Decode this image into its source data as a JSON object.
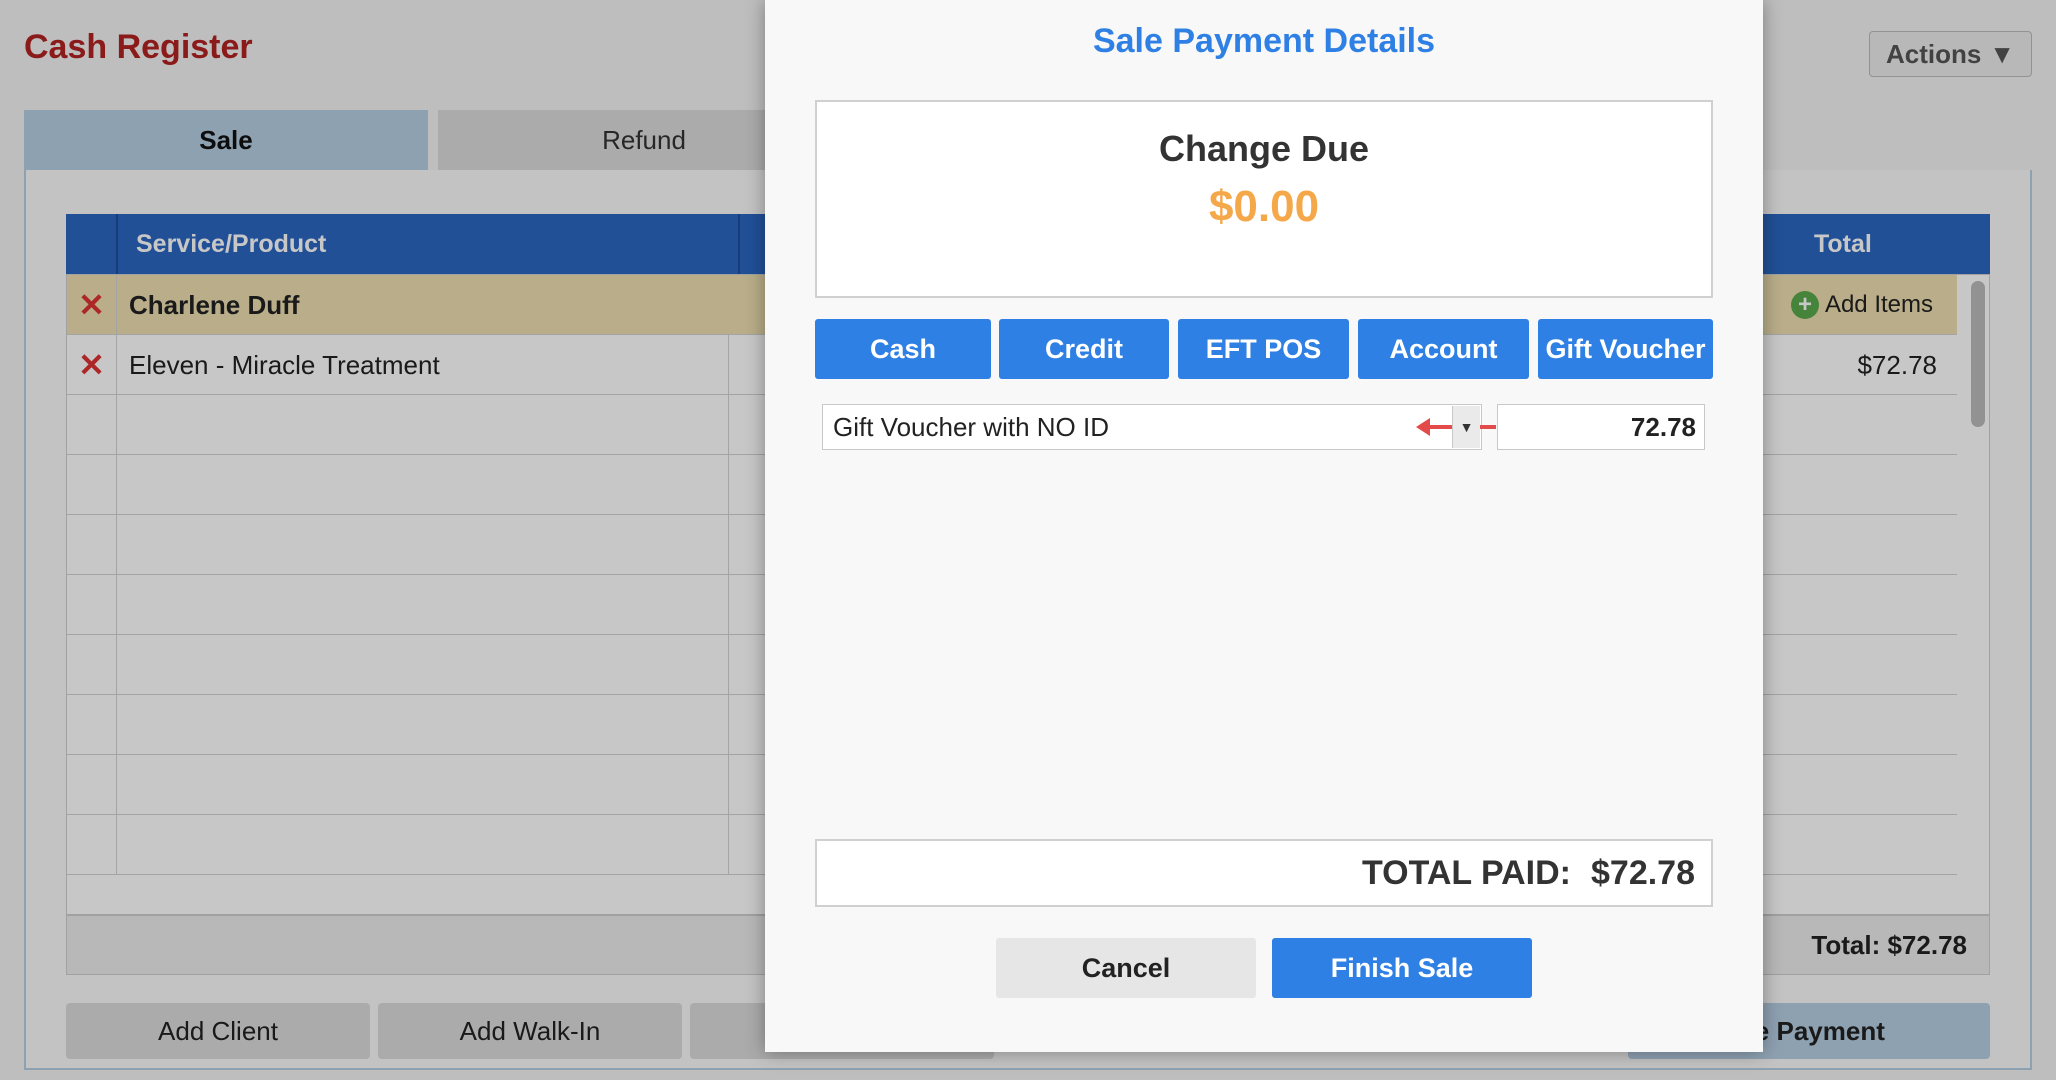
{
  "page": {
    "title": "Cash Register",
    "actions_label": "Actions",
    "actions_icon": "triangle-down-icon"
  },
  "tabs": [
    {
      "label": "Sale",
      "active": true
    },
    {
      "label": "Refund",
      "active": false
    }
  ],
  "grid": {
    "headers": {
      "service": "Service/Product",
      "total": "Total"
    },
    "client_row": {
      "name": "Charlene Duff",
      "add_items": "Add Items"
    },
    "items": [
      {
        "name": "Eleven - Miracle Treatment",
        "total": "$72.78"
      }
    ],
    "footer_total": "Total: $72.78"
  },
  "bottom_buttons": {
    "add_client": "Add Client",
    "add_walkin": "Add Walk-In",
    "receive_payment_partial": "ive Payment"
  },
  "modal": {
    "title": "Sale Payment Details",
    "change_label": "Change Due",
    "change_value": "$0.00",
    "payment_methods": [
      "Cash",
      "Credit",
      "EFT POS",
      "Account",
      "Gift Voucher"
    ],
    "voucher_select_value": "Gift Voucher with NO ID",
    "amount_value": "72.78",
    "total_paid_label": "TOTAL PAID:",
    "total_paid_value": "$72.78",
    "cancel_label": "Cancel",
    "finish_label": "Finish Sale"
  },
  "colors": {
    "title_red": "#b22222",
    "primary_blue": "#2f80e4",
    "header_blue": "#2b67c2",
    "change_orange": "#f5a84a",
    "client_row": "#eedfb0"
  }
}
